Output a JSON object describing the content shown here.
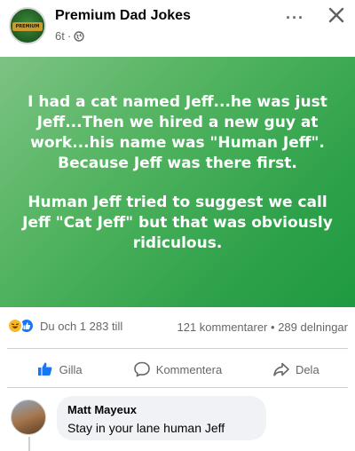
{
  "header": {
    "page_name": "Premium Dad Jokes",
    "time": "6t",
    "separator": "·",
    "more_label": "···",
    "avatar_text": "PREMIUM"
  },
  "post": {
    "paragraphs": [
      "I had a cat named Jeff...he was just Jeff...Then we hired a new guy at work...his name was \"Human Jeff\". Because Jeff was there first.",
      "Human Jeff tried to suggest we call Jeff \"Cat Jeff\" but that was obviously ridiculous."
    ],
    "background_color": "#2ea14a"
  },
  "engagement": {
    "reactions_text": "Du och 1 283 till",
    "comments_text": "121 kommentarer",
    "dot": "•",
    "shares_text": "289 delningar"
  },
  "actions": {
    "like_label": "Gilla",
    "comment_label": "Kommentera",
    "share_label": "Dela"
  },
  "comment": {
    "author": "Matt Mayeux",
    "text": "Stay in your lane human Jeff"
  },
  "colors": {
    "accent": "#1877f2",
    "muted_text": "#65676b"
  }
}
